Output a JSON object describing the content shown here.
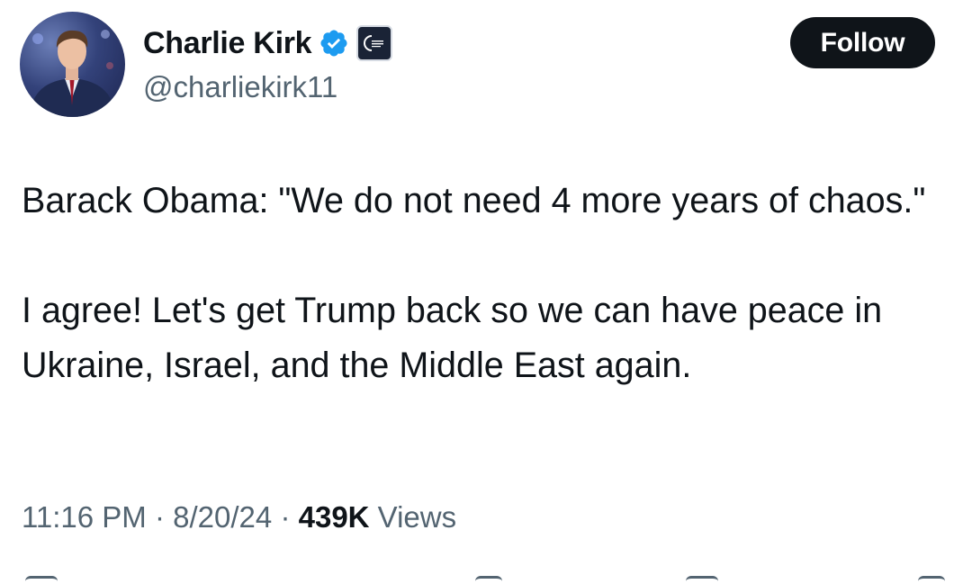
{
  "author": {
    "display_name": "Charlie Kirk",
    "handle": "@charliekirk11",
    "verified_icon": "verified-badge-icon",
    "affiliate_icon": "organization-affiliate-badge-icon",
    "avatar": "profile-photo"
  },
  "follow_button": {
    "label": "Follow"
  },
  "tweet": {
    "paragraph_1": "Barack Obama: \"We do not need 4 more years of chaos.\"",
    "paragraph_2": "I agree! Let's get Trump back so we can have peace in Ukraine, Israel, and the Middle East again."
  },
  "meta": {
    "time": "11:16 PM",
    "separator": "·",
    "date": "8/20/24",
    "views_count": "439K",
    "views_label": "Views"
  },
  "colors": {
    "text_primary": "#0f1419",
    "text_secondary": "#536471",
    "verified_blue": "#1d9bf0",
    "button_bg": "#0f1419"
  }
}
